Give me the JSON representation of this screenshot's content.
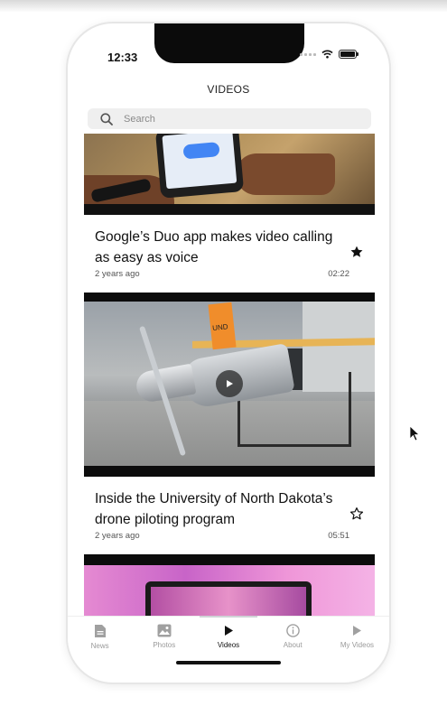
{
  "status_bar": {
    "time": "12:33"
  },
  "nav": {
    "title": "VIDEOS"
  },
  "search": {
    "placeholder": "Search"
  },
  "videos": [
    {
      "title": "Google’s Duo app makes video calling as easy as voice",
      "age": "2 years ago",
      "duration": "02:22",
      "favorited": true
    },
    {
      "title": "Inside the University of North Dakota’s drone piloting program",
      "age": "2 years ago",
      "duration": "05:51",
      "favorited": false,
      "thumb_text": "UND"
    }
  ],
  "tabs": [
    {
      "label": "News",
      "icon": "document-icon"
    },
    {
      "label": "Photos",
      "icon": "image-icon"
    },
    {
      "label": "Videos",
      "icon": "play-icon",
      "active": true
    },
    {
      "label": "About",
      "icon": "info-icon"
    },
    {
      "label": "My Videos",
      "icon": "play-icon"
    }
  ],
  "colors": {
    "accent": "#111111",
    "inactive_tab": "#9a9a9a",
    "search_bg": "#efefef"
  }
}
